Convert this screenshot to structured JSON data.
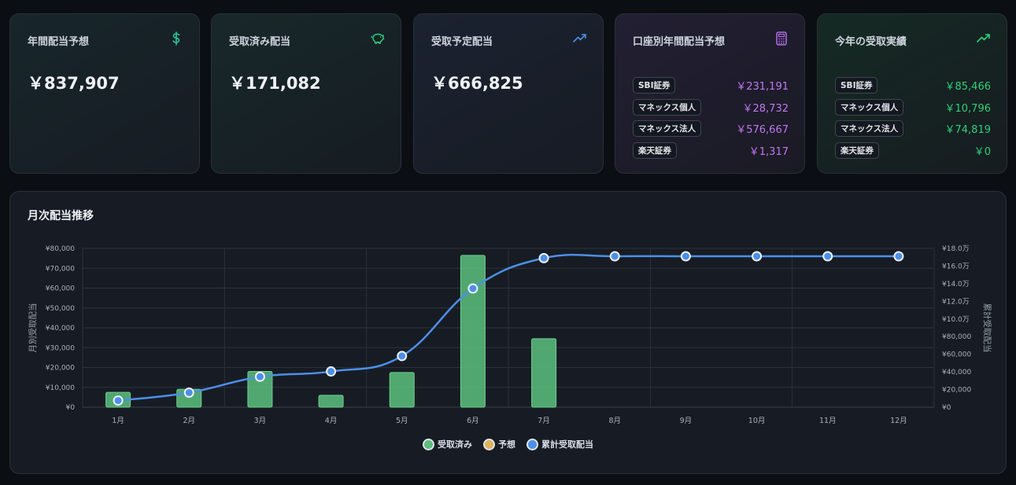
{
  "cards": {
    "annual": {
      "title": "年間配当予想",
      "value": "￥837,907",
      "icon": "dollar-icon",
      "color": "#2bc7a0"
    },
    "received": {
      "title": "受取済み配当",
      "value": "￥171,082",
      "icon": "piggy-bank-icon",
      "color": "#2fd07a"
    },
    "scheduled": {
      "title": "受取予定配当",
      "value": "￥666,825",
      "icon": "trending-up-icon",
      "color": "#4d8fe8"
    },
    "by_account": {
      "title": "口座別年間配当予想",
      "icon": "calculator-icon",
      "color": "#b06ce8",
      "rows": [
        {
          "name": "SBI証券",
          "value": "￥231,191"
        },
        {
          "name": "マネックス個人",
          "value": "￥28,732"
        },
        {
          "name": "マネックス法人",
          "value": "￥576,667"
        },
        {
          "name": "楽天証券",
          "value": "￥1,317"
        }
      ]
    },
    "this_year": {
      "title": "今年の受取実績",
      "icon": "trending-up-icon",
      "color": "#2fd07a",
      "rows": [
        {
          "name": "SBI証券",
          "value": "￥85,466"
        },
        {
          "name": "マネックス個人",
          "value": "￥10,796"
        },
        {
          "name": "マネックス法人",
          "value": "￥74,819"
        },
        {
          "name": "楽天証券",
          "value": "￥0"
        }
      ]
    }
  },
  "chart_panel": {
    "title": "月次配当推移"
  },
  "chart_data": {
    "type": "bar",
    "categories": [
      "1月",
      "2月",
      "3月",
      "4月",
      "5月",
      "6月",
      "7月",
      "8月",
      "9月",
      "10月",
      "11月",
      "12月"
    ],
    "series": [
      {
        "name": "受取済み",
        "type": "bar",
        "axis": "left",
        "color": "#5cbf7e",
        "values": [
          7500,
          9000,
          18000,
          6000,
          17500,
          76500,
          34500,
          0,
          0,
          0,
          0,
          0
        ]
      },
      {
        "name": "予想",
        "type": "bar",
        "axis": "left",
        "color": "#e0b35a",
        "values": [
          0,
          0,
          0,
          0,
          0,
          0,
          0,
          0,
          0,
          0,
          0,
          0
        ]
      },
      {
        "name": "累計受取配当",
        "type": "line",
        "axis": "right",
        "color": "#4d8fe8",
        "values": [
          7500,
          16500,
          34500,
          40500,
          58000,
          134500,
          169000,
          171082,
          171082,
          171082,
          171082,
          171082
        ]
      }
    ],
    "ylabel": "月別受取配当",
    "y2label": "累計受取配当",
    "ylim": [
      0,
      80000
    ],
    "y2lim": [
      0,
      180000
    ],
    "yticks": [
      "¥0",
      "¥10,000",
      "¥20,000",
      "¥30,000",
      "¥40,000",
      "¥50,000",
      "¥60,000",
      "¥70,000",
      "¥80,000"
    ],
    "y2ticks": [
      "¥0",
      "¥20,000",
      "¥40,000",
      "¥60,000",
      "¥80,000",
      "¥10.0万",
      "¥12.0万",
      "¥14.0万",
      "¥16.0万",
      "¥18.0万"
    ],
    "grid": true,
    "legend": "bottom"
  }
}
